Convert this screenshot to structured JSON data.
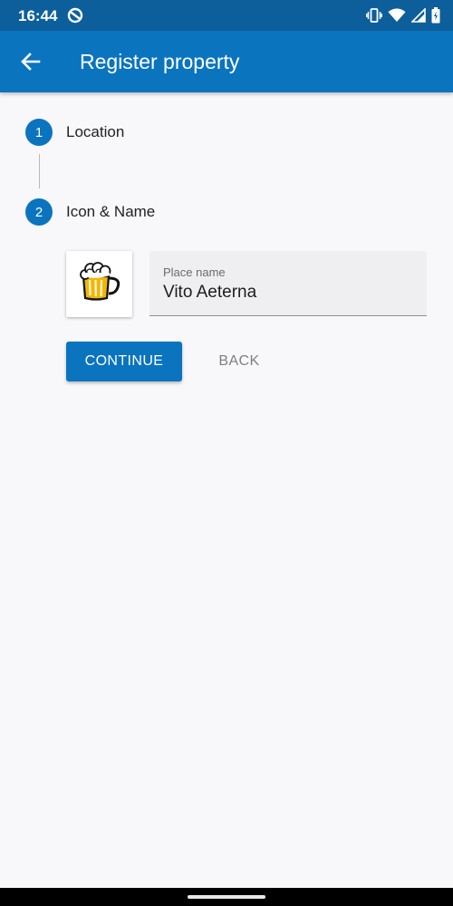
{
  "status_bar": {
    "time": "16:44",
    "icons": [
      "app-notification-icon",
      "vibrate-icon",
      "wifi-icon",
      "cellular-signal-icon",
      "battery-icon"
    ]
  },
  "app_bar": {
    "title": "Register property",
    "back_icon": "arrow-left-icon"
  },
  "stepper": {
    "steps": [
      {
        "number": "1",
        "label": "Location"
      },
      {
        "number": "2",
        "label": "Icon & Name"
      }
    ]
  },
  "form": {
    "icon": "beer-mug-icon",
    "place_name_label": "Place name",
    "place_name_value": "Vito Aeterna"
  },
  "actions": {
    "continue_label": "CONTINUE",
    "back_label": "BACK"
  },
  "colors": {
    "status_bar": "#0d5f9c",
    "primary": "#0a74bf",
    "background": "#f8f7fa",
    "field_background": "#efeef1"
  }
}
